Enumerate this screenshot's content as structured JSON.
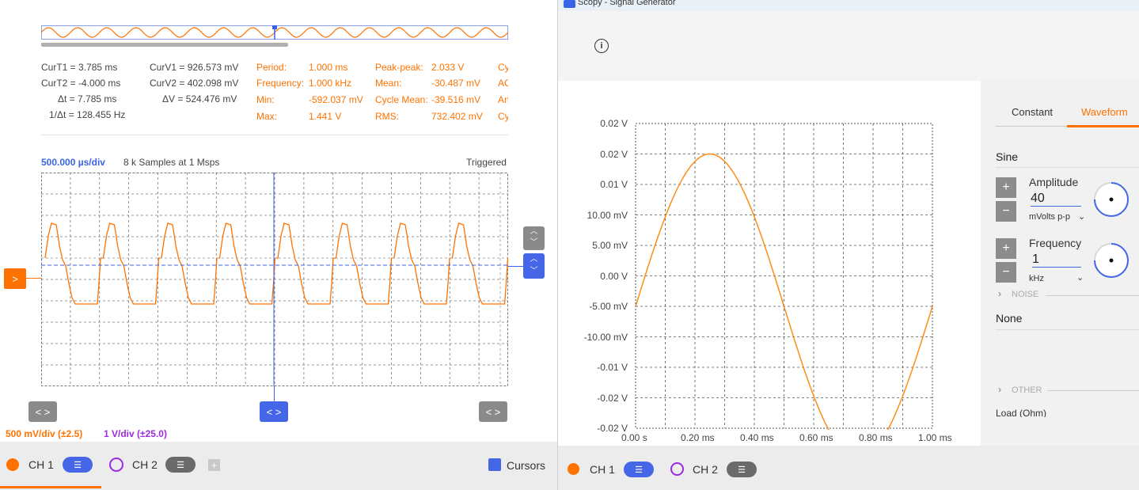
{
  "left": {
    "cursors": {
      "t1": "CurT1 = 3.785 ms",
      "t2": "CurT2 = -4.000 ms",
      "dt": "Δt = 7.785 ms",
      "inv_dt": "1/Δt = 128.455 Hz",
      "v1": "CurV1 = 926.573 mV",
      "v2": "CurV2 = 402.098 mV",
      "dv": "ΔV = 524.476 mV"
    },
    "measurements": {
      "period_label": "Period:",
      "period_value": "1.000 ms",
      "frequency_label": "Frequency:",
      "frequency_value": "1.000 kHz",
      "min_label": "Min:",
      "min_value": "-592.037 mV",
      "max_label": "Max:",
      "max_value": "1.441 V",
      "peak_label": "Peak-peak:",
      "peak_value": "2.033 V",
      "mean_label": "Mean:",
      "mean_value": "-30.487 mV",
      "cycle_mean_label": "Cycle Mean:",
      "cycle_mean_value": "-39.516 mV",
      "rms_label": "RMS:",
      "rms_value": "732.402 mV",
      "cut_1": "Cy",
      "cut_2": "AC",
      "cut_3": "An",
      "cut_4": "Cy"
    },
    "timebase": "500.000 µs/div",
    "samples": "8 k Samples at 1 Msps",
    "trigger_status": "Triggered",
    "ch1_scale": "500 mV/div (±2.5)",
    "ch2_scale": "1 V/div (±25.0)",
    "ch1_label": "CH 1",
    "ch2_label": "CH 2",
    "cursors_label": "Cursors",
    "add_symbol": "+",
    "arrow_right": ">",
    "lr_symbol": "< >",
    "colors": {
      "ch1": "#ff7200",
      "ch2": "#9a2be0",
      "cursor": "#3b63e6"
    }
  },
  "right": {
    "window_title": "Scopy - Signal Generator",
    "info_symbol": "i",
    "tabs": [
      "Constant",
      "Waveform"
    ],
    "waveform_type": "Sine",
    "amplitude": {
      "label": "Amplitude",
      "value": "40",
      "unit": "mVolts p-p"
    },
    "frequency": {
      "label": "Frequency",
      "value": "1",
      "unit": "kHz"
    },
    "noise_label": "NOISE",
    "noise_value": "None",
    "other_label": "OTHER",
    "load_label": "Load (Ohm)",
    "ch1_label": "CH 1",
    "ch2_label": "CH 2",
    "plus": "+",
    "minus": "−",
    "y_ticks": [
      "0.02 V",
      "0.02 V",
      "0.01 V",
      "10.00 mV",
      "5.00 mV",
      "0.00 V",
      "-5.00 mV",
      "-10.00 mV",
      "-0.01 V",
      "-0.02 V",
      "-0.02 V"
    ],
    "x_ticks": [
      "0.00 s",
      "0.20 ms",
      "0.40 ms",
      "0.60 ms",
      "0.80 ms",
      "1.00 ms"
    ]
  },
  "chart_data": [
    {
      "type": "line",
      "title": "",
      "xlabel": "",
      "ylabel": "",
      "x_range_ms": [
        0,
        1
      ],
      "ylim_mV": [
        -20,
        20
      ],
      "series": [
        {
          "x_ms": [
            0,
            0.125,
            0.25,
            0.375,
            0.5,
            0.625,
            0.75,
            0.875,
            1.0
          ],
          "y_mV": [
            0,
            14.1,
            20,
            14.1,
            0,
            -14.1,
            -20,
            -14.1,
            0
          ]
        }
      ]
    }
  ]
}
